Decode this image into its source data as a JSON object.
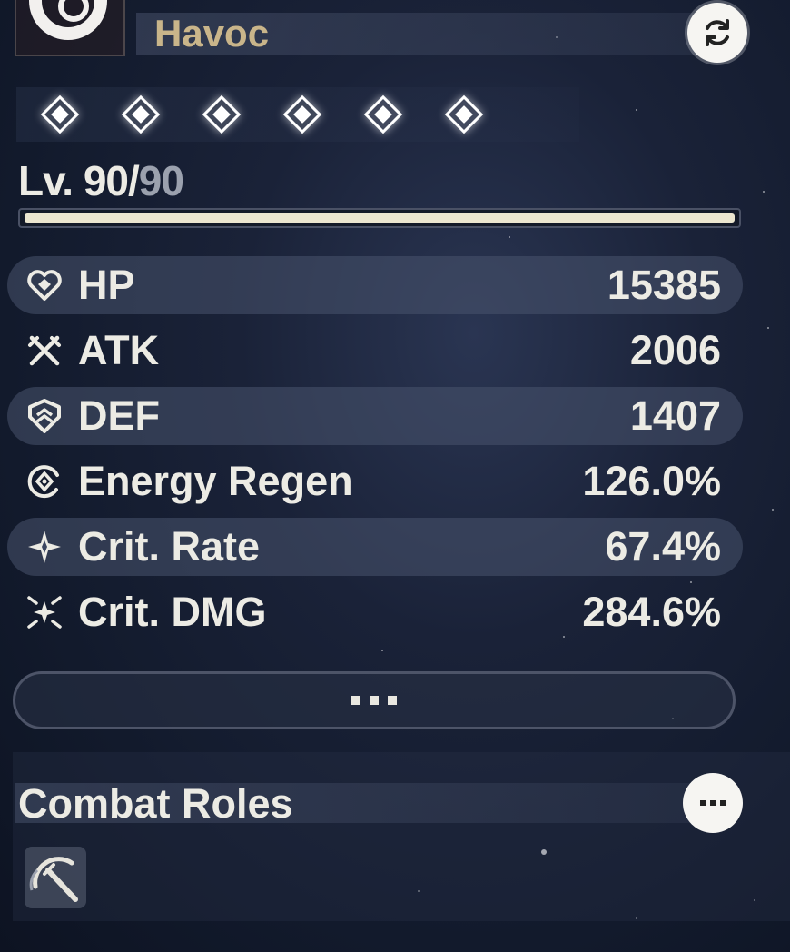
{
  "character": {
    "name": "Havoc"
  },
  "sequence": {
    "nodes": 6,
    "unlocked": 6
  },
  "level": {
    "current": "90",
    "separator": "/",
    "max": "90",
    "prefix": "Lv. ",
    "progress": 1.0
  },
  "stats": [
    {
      "icon": "heart-icon",
      "label": "HP",
      "value": "15385"
    },
    {
      "icon": "crossed-swords-icon",
      "label": "ATK",
      "value": "2006"
    },
    {
      "icon": "shield-icon",
      "label": "DEF",
      "value": "1407"
    },
    {
      "icon": "energy-regen-icon",
      "label": "Energy Regen",
      "value": "126.0%"
    },
    {
      "icon": "crit-rate-icon",
      "label": "Crit. Rate",
      "value": "67.4%"
    },
    {
      "icon": "crit-dmg-icon",
      "label": "Crit. DMG",
      "value": "284.6%"
    }
  ],
  "roles": {
    "title": "Combat Roles",
    "items": [
      {
        "icon": "scythe-blade-icon"
      }
    ]
  },
  "colors": {
    "name": "#c9b58a",
    "text": "#ecebe4",
    "bar": "#ece6cf"
  }
}
